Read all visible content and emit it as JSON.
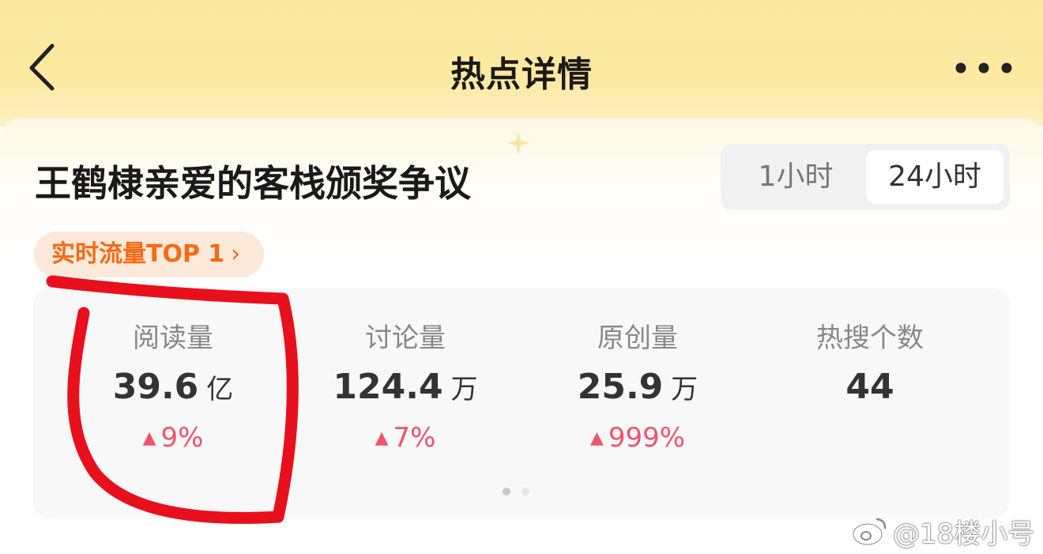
{
  "header": {
    "title": "热点详情"
  },
  "topic": {
    "title": "王鹤棣亲爱的客栈颁奖争议"
  },
  "time_toggle": {
    "options": [
      "1小时",
      "24小时"
    ],
    "selected": "24小时"
  },
  "rank_badge": {
    "text": "实时流量TOP 1",
    "chevron": "›"
  },
  "stats": [
    {
      "label": "阅读量",
      "value": "39.6",
      "unit": "亿",
      "change": "9%"
    },
    {
      "label": "讨论量",
      "value": "124.4",
      "unit": "万",
      "change": "7%"
    },
    {
      "label": "原创量",
      "value": "25.9",
      "unit": "万",
      "change": "999%"
    },
    {
      "label": "热搜个数",
      "value": "44",
      "unit": "",
      "change": ""
    }
  ],
  "carousel": {
    "page_count": 2,
    "current_page": 1
  },
  "watermark": {
    "text": "@18楼小号"
  },
  "colors": {
    "header_bg": "#fde9a0",
    "badge_text": "#f56a14",
    "change_up": "#f0536b",
    "annotation_red": "#e8101c"
  },
  "icons": {
    "back": "chevron-left-icon",
    "more": "more-dots-icon",
    "trend_up": "triangle-up-icon",
    "weibo": "weibo-logo-icon"
  }
}
